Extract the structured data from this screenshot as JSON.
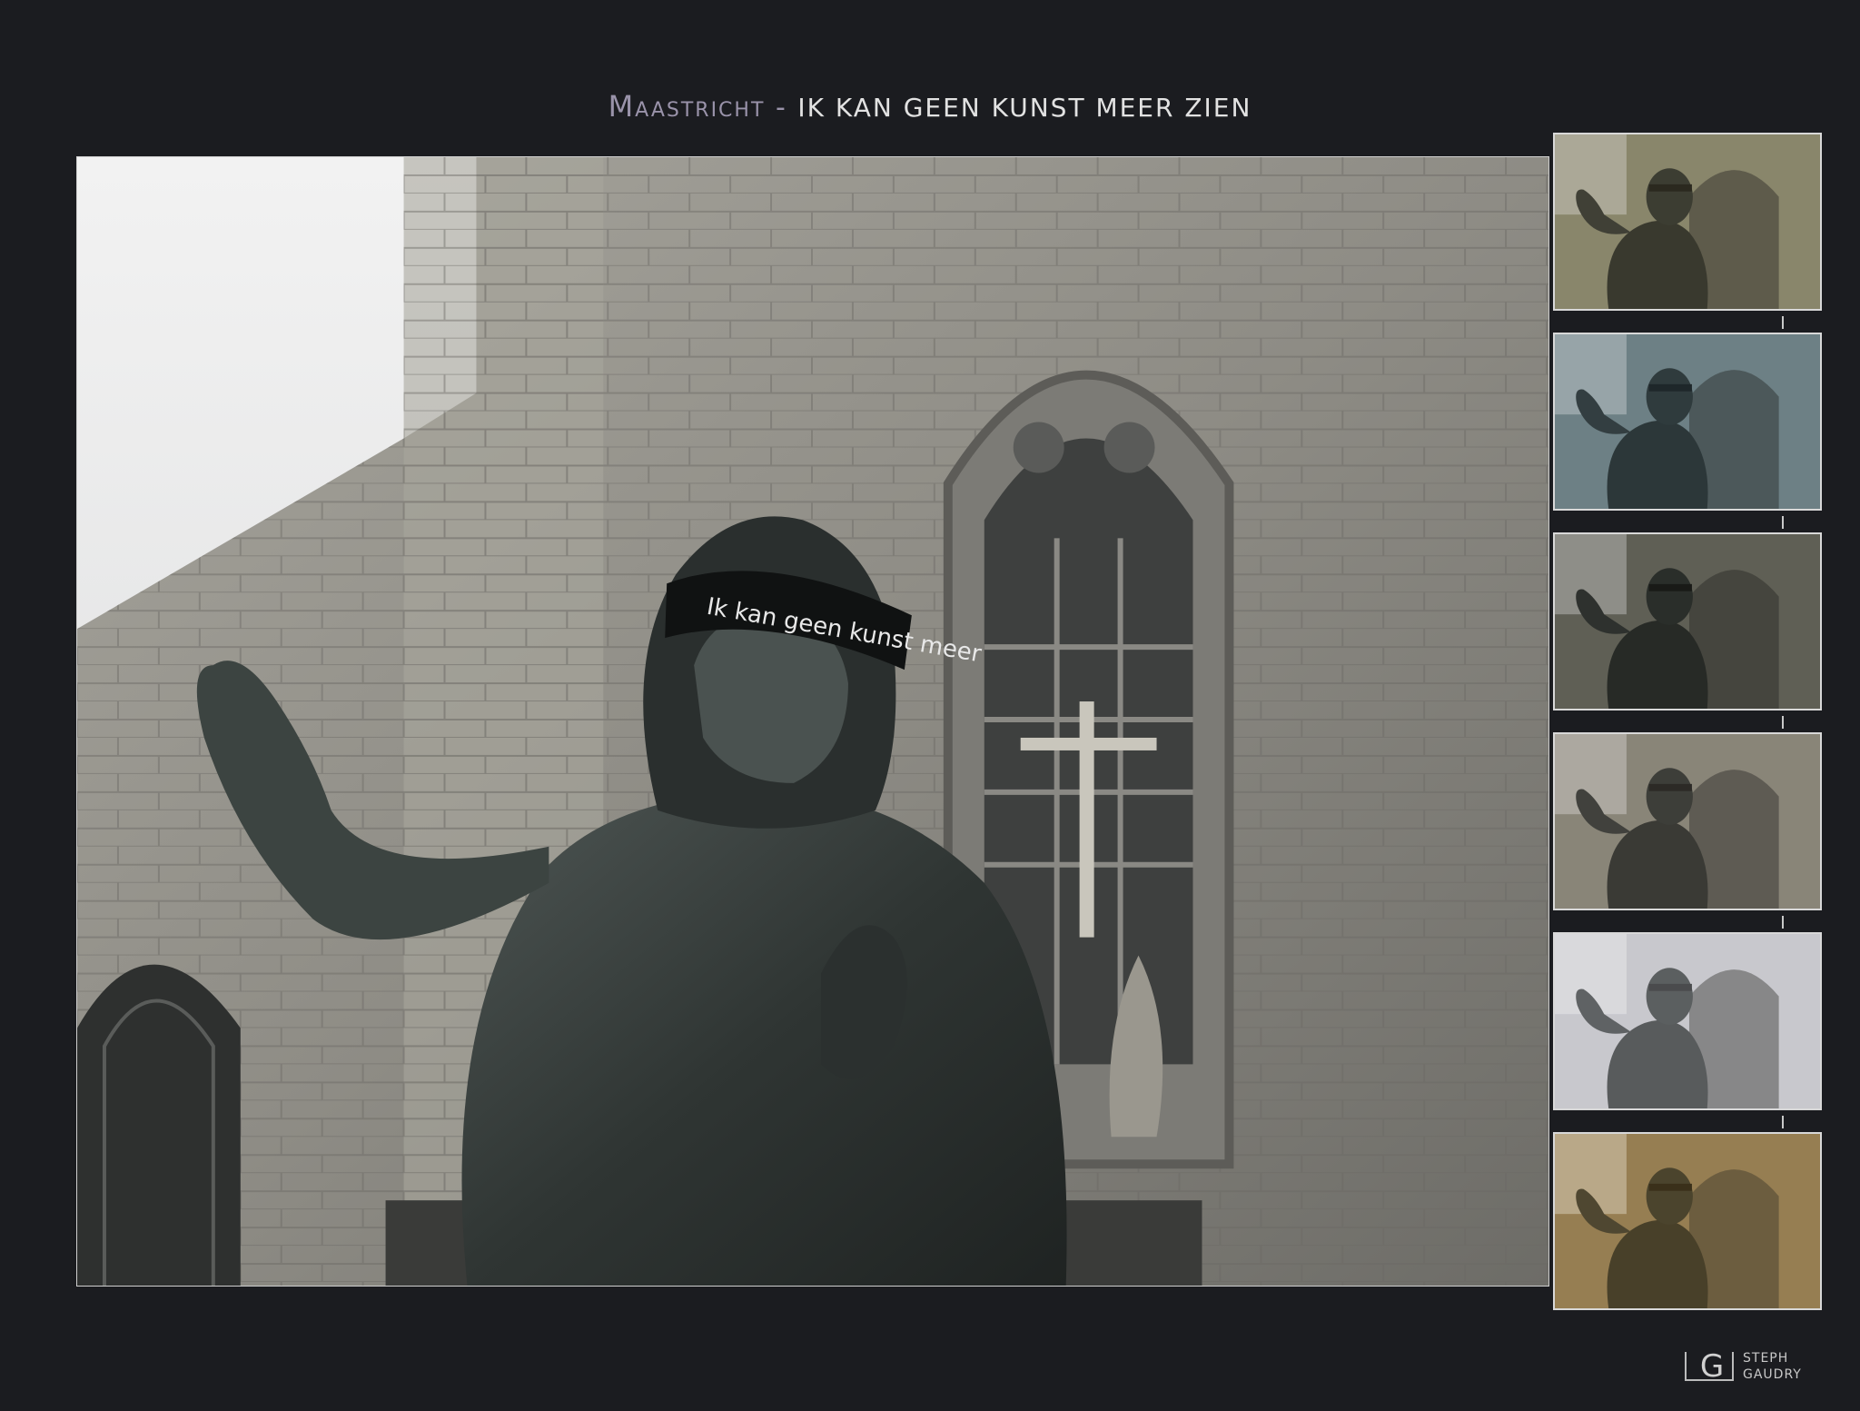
{
  "title": {
    "place": "Maastricht",
    "separator": " - ",
    "name": "IK KAN GEEN KUNST MEER ZIEN"
  },
  "photo": {
    "blindfold_text": "Ik kan geen kunst meer"
  },
  "thumbnails": [
    {
      "tint": "#8f8f78",
      "overlay": "#7a6f4a"
    },
    {
      "tint": "#7a8a8c",
      "overlay": "#4b6874"
    },
    {
      "tint": "#6e6e64",
      "overlay": "#3a3a30"
    },
    {
      "tint": "#8e8c80",
      "overlay": "#7c7264"
    },
    {
      "tint": "#bcbcc0",
      "overlay": "#e8e8f0"
    },
    {
      "tint": "#8c7a5c",
      "overlay": "#b08a3a"
    }
  ],
  "logo": {
    "glyph": "G",
    "line1": "Steph",
    "line2": "Gaudry"
  }
}
